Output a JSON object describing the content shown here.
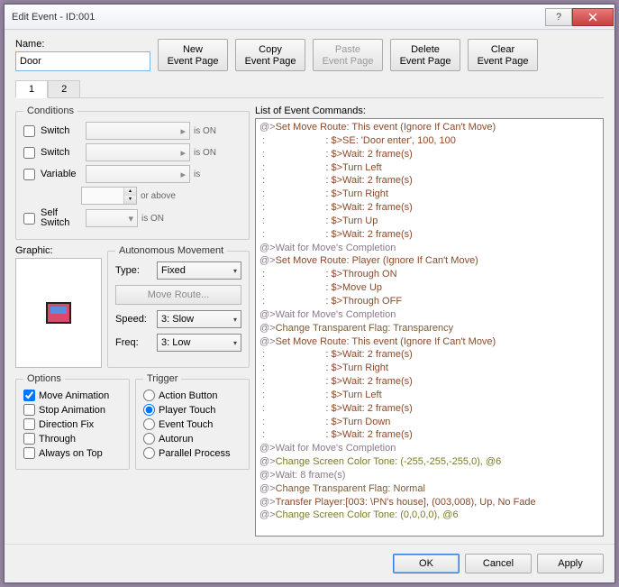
{
  "title": "Edit Event - ID:001",
  "name_label": "Name:",
  "name_value": "Door",
  "buttons": {
    "new": "New\nEvent Page",
    "copy": "Copy\nEvent Page",
    "paste": "Paste\nEvent Page",
    "delete": "Delete\nEvent Page",
    "clear": "Clear\nEvent Page"
  },
  "tabs": [
    "1",
    "2"
  ],
  "conditions": {
    "legend": "Conditions",
    "switch1": "Switch",
    "switch2": "Switch",
    "variable": "Variable",
    "or_above": "or above",
    "self_switch": "Self\nSwitch",
    "is_on": "is ON",
    "is": "is"
  },
  "graphic_label": "Graphic:",
  "autonomous": {
    "legend": "Autonomous Movement",
    "type_label": "Type:",
    "type_value": "Fixed",
    "move_route": "Move Route...",
    "speed_label": "Speed:",
    "speed_value": "3: Slow",
    "freq_label": "Freq:",
    "freq_value": "3: Low"
  },
  "options": {
    "legend": "Options",
    "move_anim": "Move Animation",
    "stop_anim": "Stop Animation",
    "dir_fix": "Direction Fix",
    "through": "Through",
    "on_top": "Always on Top"
  },
  "trigger": {
    "legend": "Trigger",
    "action": "Action Button",
    "player": "Player Touch",
    "event": "Event Touch",
    "autorun": "Autorun",
    "parallel": "Parallel Process"
  },
  "cmd_label": "List of Event Commands:",
  "commands": [
    {
      "pfx": "@>",
      "text": "Set Move Route: This event (Ignore If Can't Move)",
      "cls": "c-brown"
    },
    {
      "pfx": " :",
      "text": "                      : $>SE: 'Door enter', 100, 100",
      "cls": "c-brown"
    },
    {
      "pfx": " :",
      "text": "                      : $>Wait: 2 frame(s)",
      "cls": "c-brown"
    },
    {
      "pfx": " :",
      "text": "                      : $>Turn Left",
      "cls": "c-brown"
    },
    {
      "pfx": " :",
      "text": "                      : $>Wait: 2 frame(s)",
      "cls": "c-brown"
    },
    {
      "pfx": " :",
      "text": "                      : $>Turn Right",
      "cls": "c-brown"
    },
    {
      "pfx": " :",
      "text": "                      : $>Wait: 2 frame(s)",
      "cls": "c-brown"
    },
    {
      "pfx": " :",
      "text": "                      : $>Turn Up",
      "cls": "c-brown"
    },
    {
      "pfx": " :",
      "text": "                      : $>Wait: 2 frame(s)",
      "cls": "c-brown"
    },
    {
      "pfx": "@>",
      "text": "Wait for Move's Completion",
      "cls": "c-default"
    },
    {
      "pfx": "@>",
      "text": "Set Move Route: Player (Ignore If Can't Move)",
      "cls": "c-brown"
    },
    {
      "pfx": " :",
      "text": "                      : $>Through ON",
      "cls": "c-brown"
    },
    {
      "pfx": " :",
      "text": "                      : $>Move Up",
      "cls": "c-brown"
    },
    {
      "pfx": " :",
      "text": "                      : $>Through OFF",
      "cls": "c-brown"
    },
    {
      "pfx": "@>",
      "text": "Wait for Move's Completion",
      "cls": "c-default"
    },
    {
      "pfx": "@>",
      "text": "Change Transparent Flag: Transparency",
      "cls": "c-brown2"
    },
    {
      "pfx": "@>",
      "text": "Set Move Route: This event (Ignore If Can't Move)",
      "cls": "c-brown"
    },
    {
      "pfx": " :",
      "text": "                      : $>Wait: 2 frame(s)",
      "cls": "c-brown"
    },
    {
      "pfx": " :",
      "text": "                      : $>Turn Right",
      "cls": "c-brown"
    },
    {
      "pfx": " :",
      "text": "                      : $>Wait: 2 frame(s)",
      "cls": "c-brown"
    },
    {
      "pfx": " :",
      "text": "                      : $>Turn Left",
      "cls": "c-brown"
    },
    {
      "pfx": " :",
      "text": "                      : $>Wait: 2 frame(s)",
      "cls": "c-brown"
    },
    {
      "pfx": " :",
      "text": "                      : $>Turn Down",
      "cls": "c-brown"
    },
    {
      "pfx": " :",
      "text": "                      : $>Wait: 2 frame(s)",
      "cls": "c-brown"
    },
    {
      "pfx": "@>",
      "text": "Wait for Move's Completion",
      "cls": "c-default"
    },
    {
      "pfx": "@>",
      "text": "Change Screen Color Tone: (-255,-255,-255,0), @6",
      "cls": "c-olive"
    },
    {
      "pfx": "@>",
      "text": "Wait: 8 frame(s)",
      "cls": "c-default"
    },
    {
      "pfx": "@>",
      "text": "Change Transparent Flag: Normal",
      "cls": "c-brown2"
    },
    {
      "pfx": "@>",
      "text": "Transfer Player:[003: \\PN's house], (003,008), Up, No Fade",
      "cls": "c-brown"
    },
    {
      "pfx": "@>",
      "text": "Change Screen Color Tone: (0,0,0,0), @6",
      "cls": "c-olive"
    }
  ],
  "footer": {
    "ok": "OK",
    "cancel": "Cancel",
    "apply": "Apply"
  }
}
